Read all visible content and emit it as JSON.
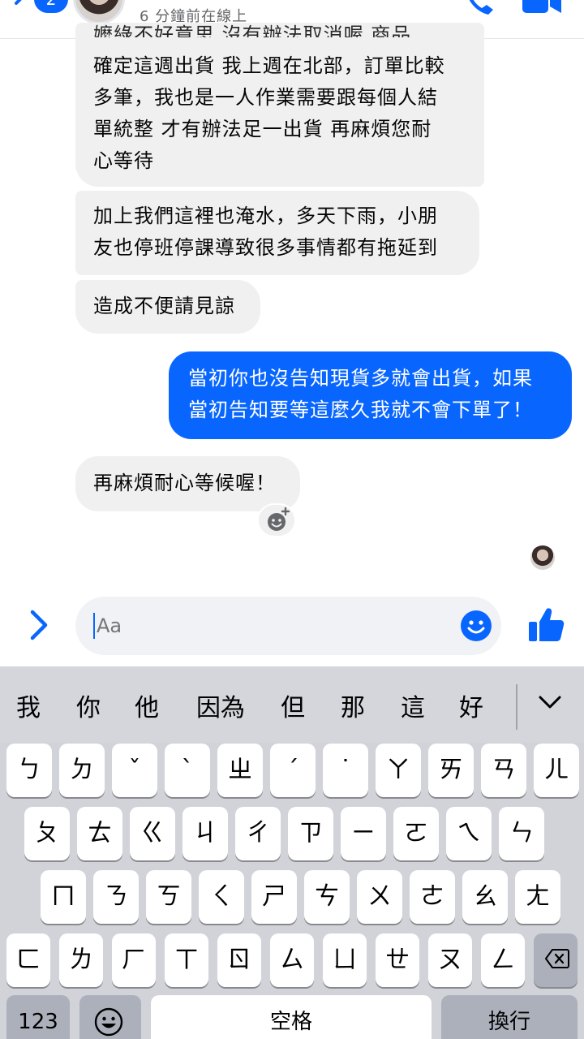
{
  "header": {
    "back_count": "2",
    "status": "6 分鐘前在線上",
    "icons": [
      "chevron-left-icon",
      "phone-icon",
      "video-camera-icon"
    ]
  },
  "messages": [
    {
      "sender": "other",
      "partial_top": "嬤綠不好意思 沒有辦法取消喔 商品",
      "lines": [
        "確定這週出貨 我上週在北部，訂單比較",
        "多筆，我也是一人作業需要跟每個人結",
        "單統整 才有辦法足一出貨 再麻煩您耐",
        "心等待"
      ]
    },
    {
      "sender": "other",
      "lines": [
        "加上我們這裡也淹水，多天下雨，小朋",
        "友也停班停課導致很多事情都有拖延到"
      ]
    },
    {
      "sender": "other",
      "lines": [
        "造成不便請見諒"
      ]
    },
    {
      "sender": "me",
      "lines": [
        "當初你也沒告知現貨多就會出貨，如果",
        "當初告知要等這麼久我就不會下單了！"
      ]
    },
    {
      "sender": "other",
      "lines": [
        "再麻煩耐心等候喔！"
      ]
    }
  ],
  "composer": {
    "placeholder": "Aa"
  },
  "keyboard": {
    "suggestions": [
      "我",
      "你",
      "他",
      "因為",
      "但",
      "那",
      "這",
      "好"
    ],
    "row1": [
      "ㄅ",
      "ㄉ",
      "ˇ",
      "ˋ",
      "ㄓ",
      "ˊ",
      "˙",
      "ㄚ",
      "ㄞ",
      "ㄢ",
      "ㄦ"
    ],
    "row2": [
      "ㄆ",
      "ㄊ",
      "ㄍ",
      "ㄐ",
      "ㄔ",
      "ㄗ",
      "ㄧ",
      "ㄛ",
      "ㄟ",
      "ㄣ"
    ],
    "row3": [
      "ㄇ",
      "ㄋ",
      "ㄎ",
      "ㄑ",
      "ㄕ",
      "ㄘ",
      "ㄨ",
      "ㄜ",
      "ㄠ",
      "ㄤ"
    ],
    "row4": [
      "ㄈ",
      "ㄌ",
      "ㄏ",
      "ㄒ",
      "ㄖ",
      "ㄙ",
      "ㄩ",
      "ㄝ",
      "ㄡ",
      "ㄥ"
    ],
    "numbers_label": "123",
    "space_label": "空格",
    "return_label": "換行"
  },
  "colors": {
    "accent": "#0866ff",
    "incoming_bubble": "#f0f0f0",
    "keyboard_bg": "#d1d3d9"
  }
}
